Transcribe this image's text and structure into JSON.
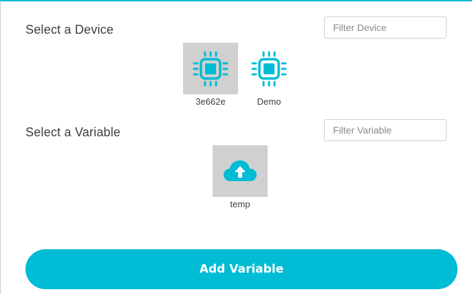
{
  "device_section": {
    "title": "Select a Device",
    "filter_placeholder": "Filter Device",
    "devices": [
      {
        "label": "3e662e",
        "selected": true,
        "icon": "chip-icon"
      },
      {
        "label": "Demo",
        "selected": false,
        "icon": "chip-icon"
      }
    ]
  },
  "variable_section": {
    "title": "Select a Variable",
    "filter_placeholder": "Filter Variable",
    "variables": [
      {
        "label": "temp",
        "selected": true,
        "icon": "cloud-upload-icon"
      }
    ]
  },
  "add_button": {
    "label": "Add Variable"
  },
  "colors": {
    "accent": "#00bcd4",
    "selected_tile": "#d0d0d0",
    "text": "#3d3d3d"
  }
}
